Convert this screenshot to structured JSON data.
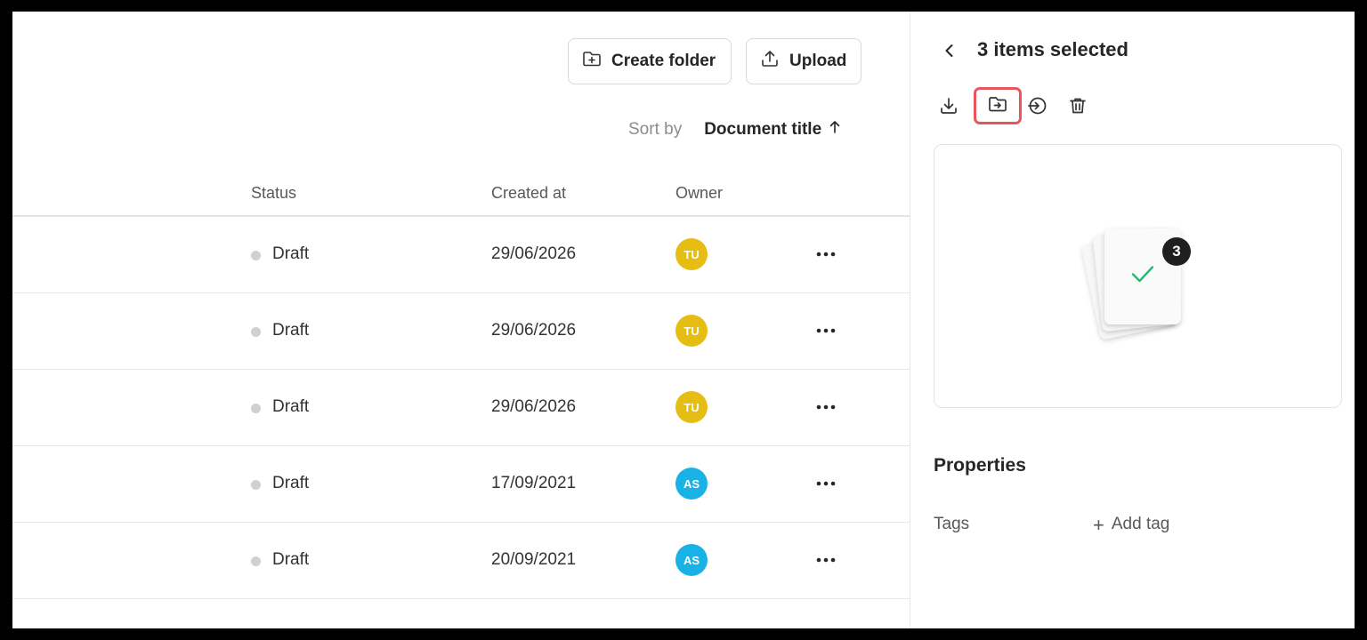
{
  "toolbar": {
    "create_folder_label": "Create folder",
    "upload_label": "Upload"
  },
  "sort": {
    "label": "Sort by",
    "value": "Document title",
    "direction_icon": "arrow-up-icon"
  },
  "table": {
    "columns": [
      "Status",
      "Created at",
      "Owner"
    ],
    "rows": [
      {
        "status": "Draft",
        "created_at": "29/06/2026",
        "owner_initials": "TU",
        "owner_color": "#e6bd13"
      },
      {
        "status": "Draft",
        "created_at": "29/06/2026",
        "owner_initials": "TU",
        "owner_color": "#e6bd13"
      },
      {
        "status": "Draft",
        "created_at": "29/06/2026",
        "owner_initials": "TU",
        "owner_color": "#e6bd13"
      },
      {
        "status": "Draft",
        "created_at": "17/09/2021",
        "owner_initials": "AS",
        "owner_color": "#19b2e6"
      },
      {
        "status": "Draft",
        "created_at": "20/09/2021",
        "owner_initials": "AS",
        "owner_color": "#19b2e6"
      }
    ]
  },
  "panel": {
    "title": "3 items selected",
    "actions": [
      "download-icon",
      "move-to-folder-icon",
      "share-icon",
      "trash-icon"
    ],
    "selected_count": "3",
    "properties_title": "Properties",
    "tags_label": "Tags",
    "add_tag_label": "Add tag"
  },
  "colors": {
    "highlight": "#e8555b",
    "check": "#2bb673",
    "status_dot": "#d0d0d0"
  }
}
